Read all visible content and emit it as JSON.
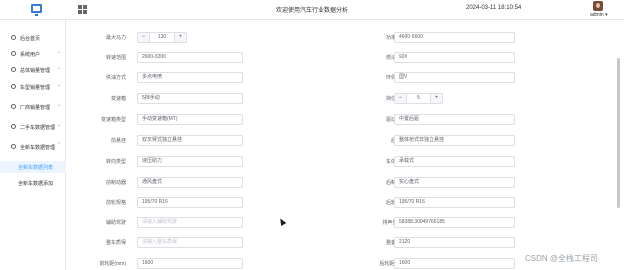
{
  "header": {
    "title": "欢迎使用汽车行业数据分析",
    "datetime": "2024-03-11 18:10:54",
    "user": "admin ▾"
  },
  "sidebar": {
    "items": [
      {
        "label": "后台首页",
        "arrow": ""
      },
      {
        "label": "系统用户",
        "arrow": "⌄"
      },
      {
        "label": "总体销量管理",
        "arrow": "⌄"
      },
      {
        "label": "车型销量管理",
        "arrow": "⌄"
      },
      {
        "label": "厂商销量管理",
        "arrow": "⌄"
      },
      {
        "label": "二手车数据管理",
        "arrow": "⌄"
      },
      {
        "label": "全新车数据管理",
        "arrow": "⌃"
      }
    ],
    "subitems": [
      {
        "label": "全新车数据列表",
        "active": true
      },
      {
        "label": "全新车数据添加",
        "active": false
      }
    ]
  },
  "form": {
    "left": [
      {
        "label": "最大马力",
        "type": "stepper",
        "value": "130"
      },
      {
        "label": "转速范围",
        "type": "text",
        "value": "2600-3200"
      },
      {
        "label": "供油方式",
        "type": "text",
        "value": "多点电喷"
      },
      {
        "label": "变速箱",
        "type": "text",
        "value": "5挡手动"
      },
      {
        "label": "变速箱类型",
        "type": "text",
        "value": "手动变速箱(MT)"
      },
      {
        "label": "前悬挂",
        "type": "text",
        "value": "双叉臂式独立悬挂"
      },
      {
        "label": "转向类型",
        "type": "text",
        "value": "液压助力"
      },
      {
        "label": "前制动器",
        "type": "text",
        "value": "通风盘式"
      },
      {
        "label": "前轮规格",
        "type": "text",
        "value": "195/70 R16"
      },
      {
        "label": "辅助驾驶",
        "type": "text",
        "value": "请输入辅助驾驶",
        "placeholder": true
      },
      {
        "label": "整车质保",
        "type": "text",
        "value": "请输入整车质保",
        "placeholder": true
      },
      {
        "label": "前轮距(mm)",
        "type": "text",
        "value": "1600"
      }
    ],
    "right": [
      {
        "label": "功率范围",
        "type": "text",
        "value": "4600-5600"
      },
      {
        "label": "燃油标号",
        "type": "text",
        "value": "92#"
      },
      {
        "label": "环保标准",
        "type": "text",
        "value": "国V"
      },
      {
        "label": "挡位数量",
        "type": "stepper",
        "value": "5"
      },
      {
        "label": "驱动方式",
        "type": "text",
        "value": "中置后驱"
      },
      {
        "label": "后悬挂",
        "type": "text",
        "value": "整体桥式非独立悬挂"
      },
      {
        "label": "车体结构",
        "type": "text",
        "value": "承载式"
      },
      {
        "label": "后制动器",
        "type": "text",
        "value": "实心盘式"
      },
      {
        "label": "后轮规格",
        "type": "text",
        "value": "195/70 R16"
      },
      {
        "label": "排声量(ml)",
        "type": "text",
        "value": "58388.30049765185"
      },
      {
        "label": "整备质量",
        "type": "text",
        "value": "2120"
      },
      {
        "label": "后轮距(mm)",
        "type": "text",
        "value": "1600"
      }
    ]
  },
  "stepper_symbols": {
    "minus": "−",
    "plus": "+"
  },
  "watermark": "CSDN @全栈工程司"
}
